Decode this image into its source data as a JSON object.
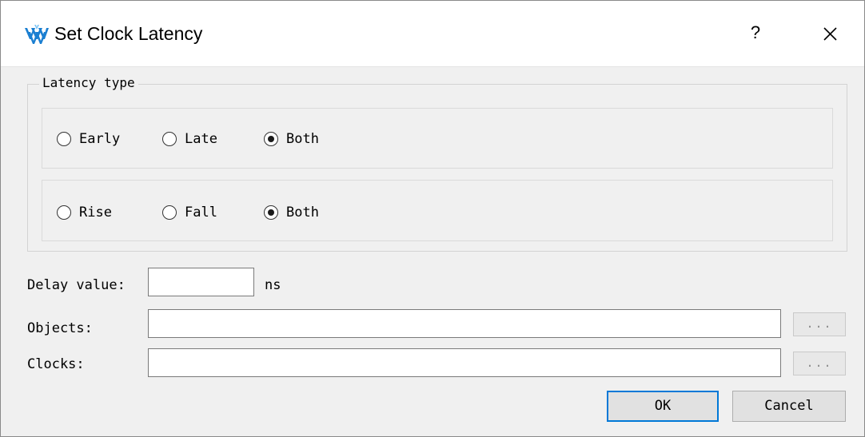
{
  "window": {
    "title": "Set Clock Latency",
    "help_label": "?",
    "close_icon": "close-icon",
    "app_icon": "gowin-logo-icon"
  },
  "latency_type": {
    "legend": "Latency type",
    "early_late": {
      "options": [
        "Early",
        "Late",
        "Both"
      ],
      "selected": "Both"
    },
    "rise_fall": {
      "options": [
        "Rise",
        "Fall",
        "Both"
      ],
      "selected": "Both"
    }
  },
  "fields": {
    "delay_label": "Delay value:",
    "delay_value": "",
    "delay_unit": "ns",
    "objects_label": "Objects:",
    "objects_value": "",
    "clocks_label": "Clocks:",
    "clocks_value": "",
    "browse_label": "..."
  },
  "buttons": {
    "ok": "OK",
    "cancel": "Cancel"
  },
  "colors": {
    "background": "#f0f0f0",
    "titlebar": "#ffffff",
    "focus_border": "#0078d7",
    "logo": "#1b7fd1"
  }
}
